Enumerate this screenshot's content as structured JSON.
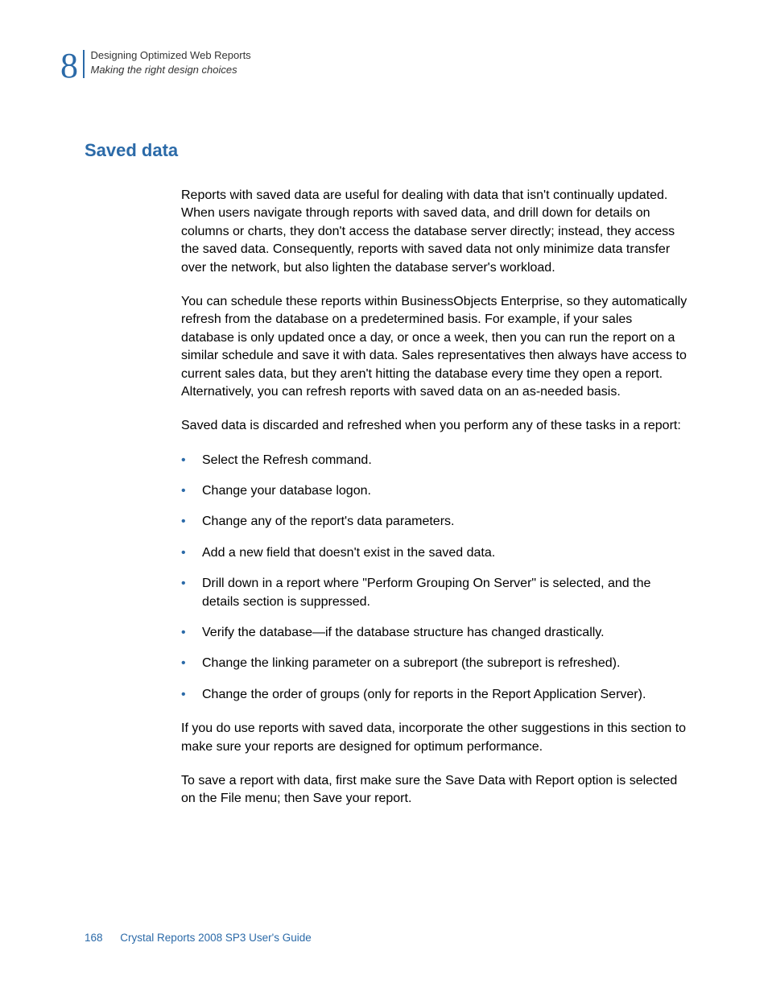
{
  "header": {
    "chapter_num": "8",
    "chapter_title": "Designing Optimized Web Reports",
    "section_title": "Making the right design choices"
  },
  "heading": "Saved data",
  "paragraphs": {
    "p1": "Reports with saved data are useful for dealing with data that isn't continually updated. When users navigate through reports with saved data, and drill down for details on columns or charts, they don't access the database server directly; instead, they access the saved data. Consequently, reports with saved data not only minimize data transfer over the network, but also lighten the database server's workload.",
    "p2": "You can schedule these reports within BusinessObjects Enterprise, so they automatically refresh from the database on a predetermined basis. For example, if your sales database is only updated once a day, or once a week, then you can run the report on a similar schedule and save it with data. Sales representatives then always have access to current sales data, but they aren't hitting the database every time they open a report. Alternatively, you can refresh reports with saved data on an as-needed basis.",
    "p3": "Saved data is discarded and refreshed when you perform any of these tasks in a report:",
    "p4": "If you do use reports with saved data, incorporate the other suggestions in this section to make sure your reports are designed for optimum performance.",
    "p5": "To save a report with data, first make sure the Save Data with Report option is selected on the File menu; then Save your report."
  },
  "bullets": {
    "b1": "Select the Refresh command.",
    "b2": "Change your database logon.",
    "b3": "Change any of the report's data parameters.",
    "b4": "Add a new field that doesn't exist in the saved data.",
    "b5": "Drill down in a report where \"Perform Grouping On Server\" is selected, and the details section is suppressed.",
    "b6": "Verify the database—if the database structure has changed drastically.",
    "b7": "Change the linking parameter on a subreport (the subreport is refreshed).",
    "b8": "Change the order of groups (only for reports in the Report Application Server)."
  },
  "footer": {
    "page_num": "168",
    "guide_name": "Crystal Reports 2008 SP3 User's Guide"
  }
}
